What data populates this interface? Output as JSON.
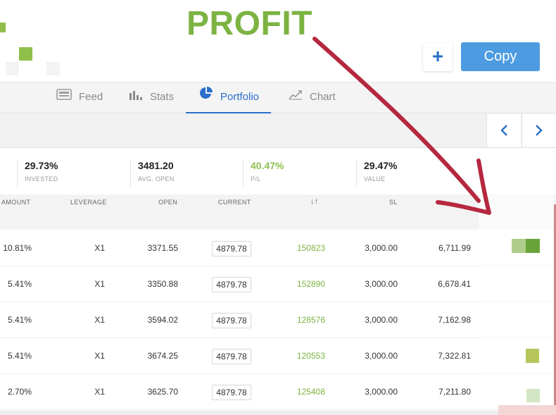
{
  "annotation": {
    "text": "PROFIT",
    "color": "#7cb342",
    "arrow_color": "#b5283f"
  },
  "actions": {
    "plus_label": "+",
    "copy_label": "Copy"
  },
  "tabs": [
    {
      "label": "Feed",
      "icon": "feed-icon"
    },
    {
      "label": "Stats",
      "icon": "stats-icon"
    },
    {
      "label": "Portfolio",
      "icon": "pie-chart-icon",
      "active": true
    },
    {
      "label": "Chart",
      "icon": "chart-icon"
    }
  ],
  "pager": {
    "prev": "‹",
    "next": "›"
  },
  "stats": [
    {
      "value": "29.73%",
      "label": "INVESTED"
    },
    {
      "value": "3481.20",
      "label": "AVG. OPEN"
    },
    {
      "value": "40.47%",
      "label": "P/L"
    },
    {
      "value": "29.47%",
      "label": "VALUE"
    }
  ],
  "columns": [
    "AMOUNT",
    "LEVERAGE",
    "OPEN",
    "CURRENT",
    "↓↑",
    "SL"
  ],
  "rows": [
    {
      "amount": "10.81%",
      "leverage": "X1",
      "open": "3371.55",
      "current": "4879.78",
      "units": "150823",
      "sl": "3,000.00",
      "tp": "6,711.99"
    },
    {
      "amount": "5.41%",
      "leverage": "X1",
      "open": "3350.88",
      "current": "4879.78",
      "units": "152890",
      "sl": "3,000.00",
      "tp": "6,678.41"
    },
    {
      "amount": "5.41%",
      "leverage": "X1",
      "open": "3594.02",
      "current": "4879.78",
      "units": "128576",
      "sl": "3,000.00",
      "tp": "7,162.98"
    },
    {
      "amount": "5.41%",
      "leverage": "X1",
      "open": "3674.25",
      "current": "4879.78",
      "units": "120553",
      "sl": "3,000.00",
      "tp": "7,322.81"
    },
    {
      "amount": "2.70%",
      "leverage": "X1",
      "open": "3625.70",
      "current": "4879.78",
      "units": "125408",
      "sl": "3,000.00",
      "tp": "7,211.80"
    }
  ],
  "colors": {
    "accent": "#2a6fc9",
    "copy_button": "#4d9be0",
    "positive": "#7cb342"
  }
}
